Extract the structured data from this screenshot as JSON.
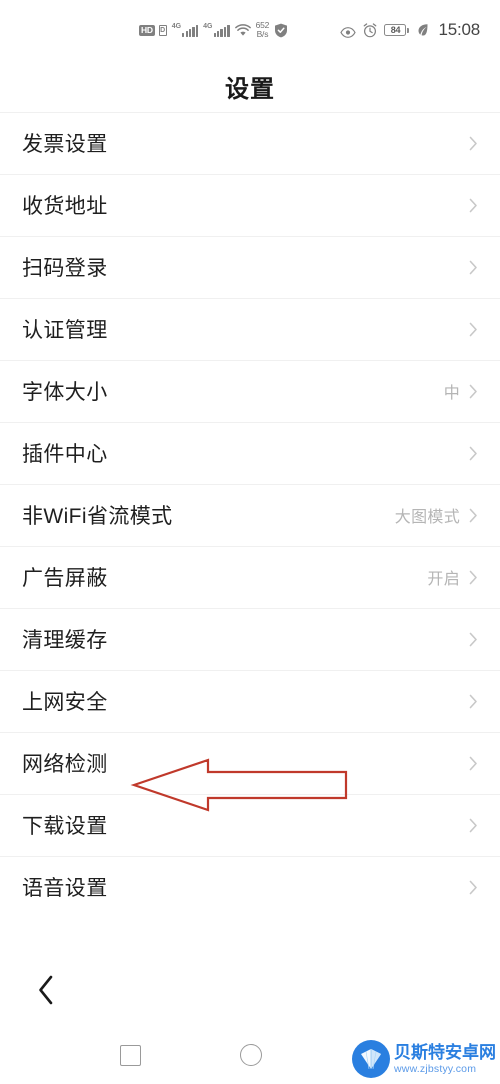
{
  "status_bar": {
    "hd_label": "HD",
    "data_label": "D",
    "sim1_gen": "4G",
    "sim2_gen": "4G",
    "wifi_icon": "wifi-icon",
    "net_speed_value": "652",
    "net_speed_unit": "B/s",
    "shield_icon": "shield-check-icon",
    "eye_icon": "eye-icon",
    "alarm_icon": "alarm-clock-icon",
    "battery_level": "84",
    "leaf_icon": "leaf-power-save-icon",
    "time": "15:08"
  },
  "header": {
    "title": "设置"
  },
  "list": {
    "items": [
      {
        "label": "发票设置",
        "value": ""
      },
      {
        "label": "收货地址",
        "value": ""
      },
      {
        "label": "扫码登录",
        "value": ""
      },
      {
        "label": "认证管理",
        "value": ""
      },
      {
        "label": "字体大小",
        "value": "中"
      },
      {
        "label": "插件中心",
        "value": ""
      },
      {
        "label": "非WiFi省流模式",
        "value": "大图模式"
      },
      {
        "label": "广告屏蔽",
        "value": "开启"
      },
      {
        "label": "清理缓存",
        "value": ""
      },
      {
        "label": "上网安全",
        "value": ""
      },
      {
        "label": "网络检测",
        "value": ""
      },
      {
        "label": "下载设置",
        "value": ""
      },
      {
        "label": "语音设置",
        "value": ""
      }
    ],
    "chevron_icon": "chevron-right-icon"
  },
  "annotation": {
    "shape": "left-arrow-outline",
    "color": "#c0392b",
    "points_to": "网络检测"
  },
  "back_button": {
    "icon": "chevron-left-icon"
  },
  "nav_bar": {
    "recent_icon": "square-recent-apps-icon",
    "home_icon": "circle-home-icon",
    "back_icon": "triangle-back-icon"
  },
  "watermark": {
    "logo_icon": "shell-logo-icon",
    "site_name": "贝斯特安卓网",
    "site_url": "www.zjbstyy.com",
    "brand_color": "#2a7fe0"
  }
}
